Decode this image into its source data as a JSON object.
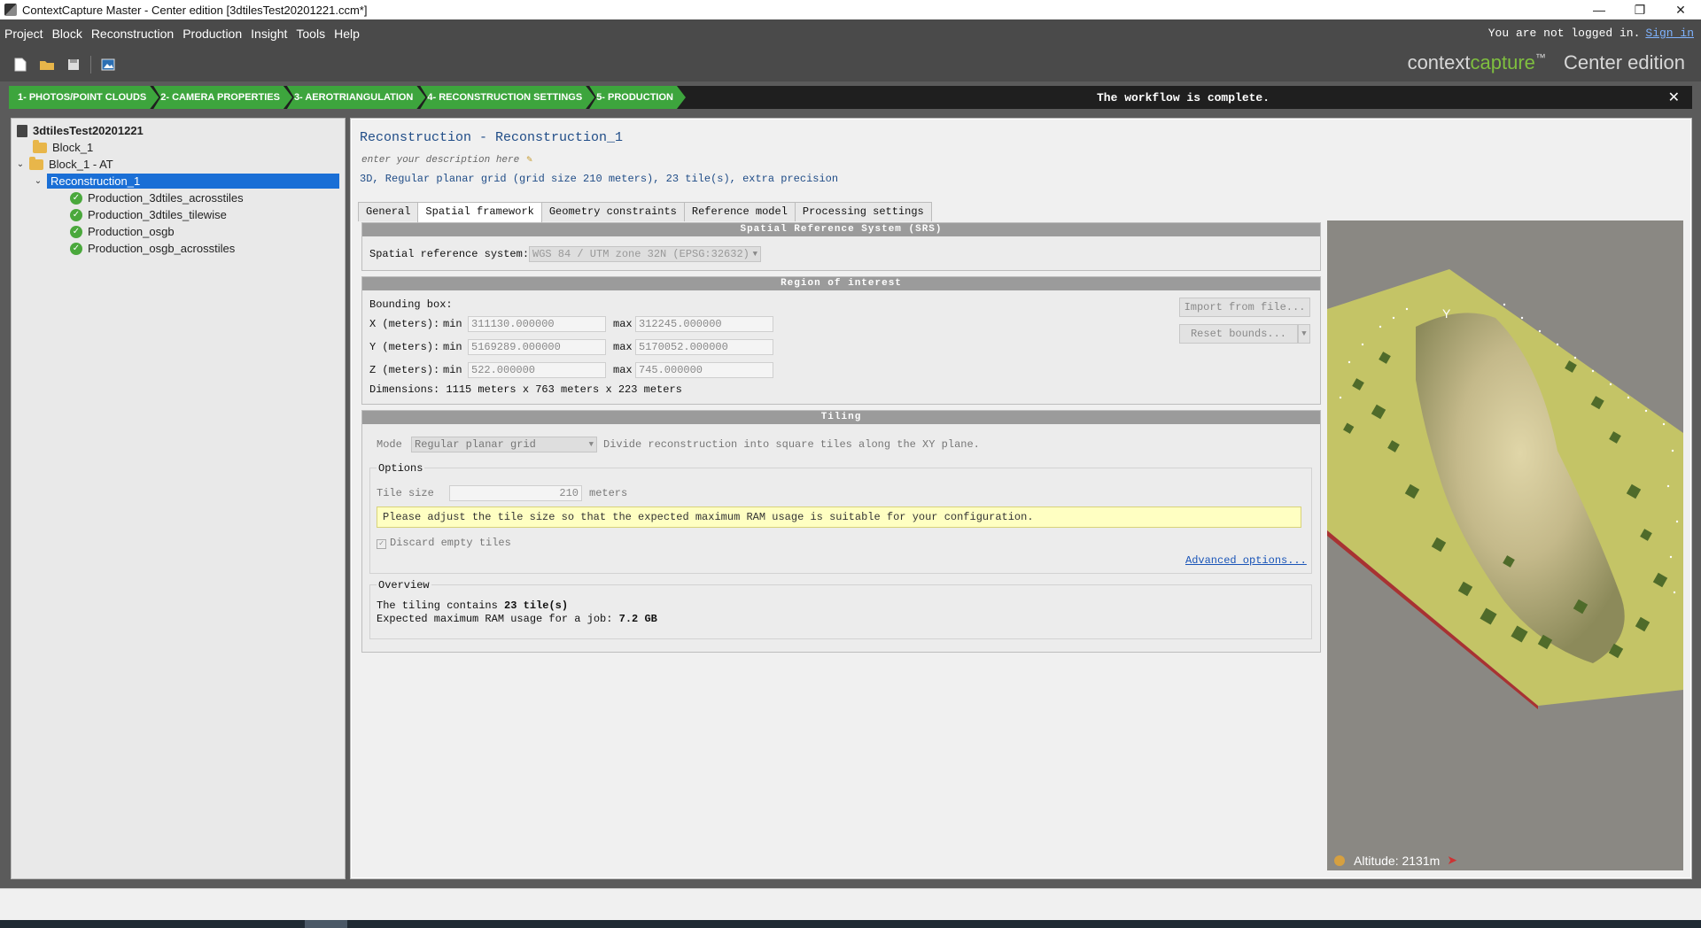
{
  "window": {
    "title": "ContextCapture Master - Center edition [3dtilesTest20201221.ccm*]",
    "controls": [
      "—",
      "❐",
      "✕"
    ]
  },
  "menu": {
    "items": [
      "Project",
      "Block",
      "Reconstruction",
      "Production",
      "Insight",
      "Tools",
      "Help"
    ],
    "login_text": "You are not logged in.",
    "sign_in": "Sign in"
  },
  "brand": {
    "context": "context",
    "capture": "capture",
    "tm": "™",
    "edition": "Center edition"
  },
  "workflow": {
    "steps": [
      "1- PHOTOS/POINT CLOUDS",
      "2- CAMERA PROPERTIES",
      "3- AEROTRIANGULATION",
      "4- RECONSTRUCTION SETTINGS",
      "5- PRODUCTION"
    ],
    "status": "The workflow is complete.",
    "close": "✕"
  },
  "tree": {
    "project": "3dtilesTest20201221",
    "block1": "Block_1",
    "block_at": "Block_1 - AT",
    "reconstruction": "Reconstruction_1",
    "productions": [
      "Production_3dtiles_acrosstiles",
      "Production_3dtiles_tilewise",
      "Production_osgb",
      "Production_osgb_acrosstiles"
    ]
  },
  "reconstruction": {
    "title": "Reconstruction - Reconstruction_1",
    "description_placeholder": "enter your description here",
    "summary": "3D, Regular planar grid (grid size 210 meters), 23 tile(s), extra precision",
    "tabs": [
      "General",
      "Spatial framework",
      "Geometry constraints",
      "Reference model",
      "Processing settings"
    ],
    "active_tab": "Spatial framework"
  },
  "srs": {
    "header": "Spatial Reference System (SRS)",
    "label": "Spatial reference system:",
    "value": "WGS 84 / UTM zone 32N (EPSG:32632)"
  },
  "roi": {
    "header": "Region of interest",
    "bbox_label": "Bounding box:",
    "x_label": "X (meters):",
    "y_label": "Y (meters):",
    "z_label": "Z (meters):",
    "min_label": "min",
    "max_label": "max",
    "x_min": "311130.000000",
    "x_max": "312245.000000",
    "y_min": "5169289.000000",
    "y_max": "5170052.000000",
    "z_min": "522.000000",
    "z_max": "745.000000",
    "dimensions": "Dimensions: 1115 meters x 763 meters x 223 meters",
    "import_button": "Import from file...",
    "reset_button": "Reset bounds..."
  },
  "tiling": {
    "header": "Tiling",
    "mode_label": "Mode",
    "mode_value": "Regular planar grid",
    "mode_desc": "Divide reconstruction into square tiles along the XY plane.",
    "options_label": "Options",
    "tile_size_label": "Tile size",
    "tile_size_value": "210",
    "tile_size_unit": "meters",
    "warning": "Please adjust the tile size so that the expected maximum RAM usage is suitable for your configuration.",
    "discard_label": "Discard empty tiles",
    "advanced_link": "Advanced options...",
    "overview_label": "Overview",
    "overview_tiles_prefix": "The tiling contains ",
    "overview_tiles_value": "23 tile(s)",
    "overview_ram_prefix": "Expected maximum RAM usage for a job: ",
    "overview_ram_value": "7.2 GB"
  },
  "viewer": {
    "altitude_label": "Altitude:",
    "altitude_value": "2131m",
    "axis_label": "Y",
    "colors": {
      "ground": "#c4c466",
      "terrain": "#c8c08c",
      "vegetation": "#4f6b2a"
    }
  }
}
